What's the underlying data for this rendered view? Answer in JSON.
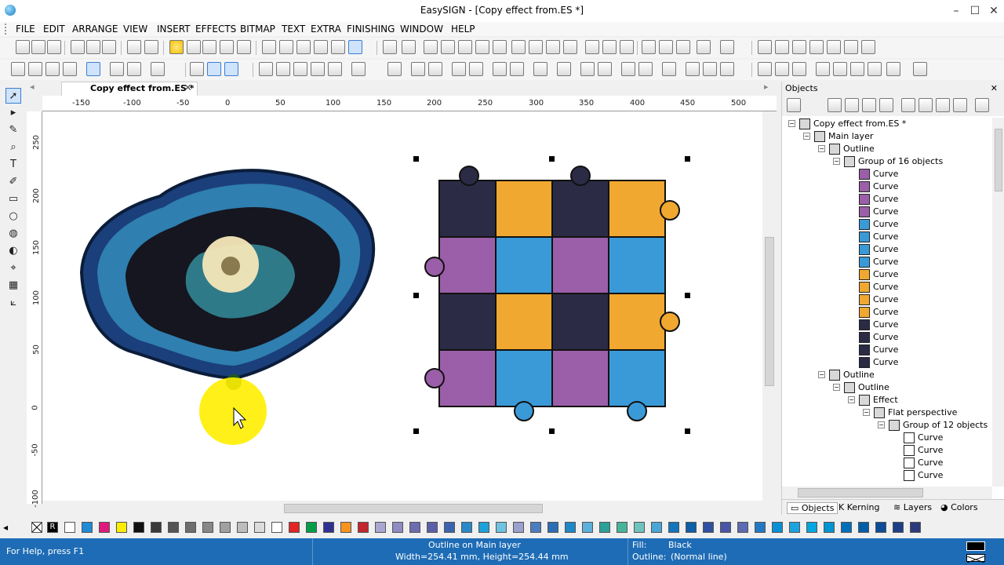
{
  "window": {
    "title": "EasySIGN - [Copy effect from.ES *]",
    "minimize": "–",
    "maximize": "☐",
    "close": "✕"
  },
  "menu": [
    "FILE",
    "EDIT",
    "ARRANGE",
    "VIEW",
    "INSERT",
    "EFFECTS",
    "BITMAP",
    "TEXT",
    "EXTRA",
    "FINISHING",
    "WINDOW",
    "HELP"
  ],
  "document": {
    "tab_label": "Copy effect from.ES *",
    "tab_close": "✕"
  },
  "ruler": {
    "h": [
      "-150",
      "-100",
      "-50",
      "0",
      "50",
      "100",
      "150",
      "200",
      "250",
      "300",
      "350",
      "400",
      "450",
      "500"
    ],
    "v": [
      "250",
      "200",
      "150",
      "100",
      "50",
      "0",
      "-50",
      "-100"
    ]
  },
  "objects_panel": {
    "title": "Objects",
    "close": "✕",
    "tree": [
      {
        "label": "Copy effect from.ES *",
        "depth": 0,
        "exp": "−",
        "icon": "document"
      },
      {
        "label": "Main layer",
        "depth": 1,
        "exp": "−",
        "icon": "layer"
      },
      {
        "label": "Outline",
        "depth": 2,
        "exp": "−",
        "icon": "outline"
      },
      {
        "label": "Group of 16 objects",
        "depth": 3,
        "exp": "−",
        "icon": "group"
      },
      {
        "label": "Curve",
        "depth": 4,
        "color": "#9b5ea8"
      },
      {
        "label": "Curve",
        "depth": 4,
        "color": "#9b5ea8"
      },
      {
        "label": "Curve",
        "depth": 4,
        "color": "#9b5ea8"
      },
      {
        "label": "Curve",
        "depth": 4,
        "color": "#9b5ea8"
      },
      {
        "label": "Curve",
        "depth": 4,
        "color": "#3a9ad8"
      },
      {
        "label": "Curve",
        "depth": 4,
        "color": "#3a9ad8"
      },
      {
        "label": "Curve",
        "depth": 4,
        "color": "#3a9ad8"
      },
      {
        "label": "Curve",
        "depth": 4,
        "color": "#3a9ad8"
      },
      {
        "label": "Curve",
        "depth": 4,
        "color": "#f0a830"
      },
      {
        "label": "Curve",
        "depth": 4,
        "color": "#f0a830"
      },
      {
        "label": "Curve",
        "depth": 4,
        "color": "#f0a830"
      },
      {
        "label": "Curve",
        "depth": 4,
        "color": "#f0a830"
      },
      {
        "label": "Curve",
        "depth": 4,
        "color": "#2b2b45"
      },
      {
        "label": "Curve",
        "depth": 4,
        "color": "#2b2b45"
      },
      {
        "label": "Curve",
        "depth": 4,
        "color": "#2b2b45"
      },
      {
        "label": "Curve",
        "depth": 4,
        "color": "#2b2b45"
      },
      {
        "label": "Outline",
        "depth": 2,
        "exp": "−",
        "icon": "outline"
      },
      {
        "label": "Outline",
        "depth": 3,
        "exp": "−",
        "icon": "outline"
      },
      {
        "label": "Effect",
        "depth": 4,
        "exp": "−",
        "icon": "effect"
      },
      {
        "label": "Flat perspective",
        "depth": 5,
        "exp": "−",
        "icon": "perspective"
      },
      {
        "label": "Group of 12 objects",
        "depth": 6,
        "exp": "−",
        "icon": "group"
      },
      {
        "label": "Curve",
        "depth": 7,
        "color": "#ffffff"
      },
      {
        "label": "Curve",
        "depth": 7,
        "color": "#ffffff"
      },
      {
        "label": "Curve",
        "depth": 7,
        "color": "#ffffff"
      },
      {
        "label": "Curve",
        "depth": 7,
        "color": "#ffffff"
      }
    ],
    "tabs": [
      "Objects",
      "Kerning",
      "Layers",
      "Colors"
    ]
  },
  "palette": [
    "#ffffff",
    "#1f8ad6",
    "#e0197d",
    "#ffed00",
    "#111111",
    "#3a3a3a",
    "#555555",
    "#6e6e6e",
    "#888888",
    "#a0a0a0",
    "#bdbdbd",
    "#dcdcdc",
    "#ffffff",
    "#e32524",
    "#009e49",
    "#2e3192",
    "#f7941d",
    "#c1272d",
    "#a9a7d2",
    "#8f8bc3",
    "#6d6cb0",
    "#5b5fa8",
    "#3c64ae",
    "#2b88c8",
    "#1da1d9",
    "#6fc3e0",
    "#9aa1cf",
    "#4c7dbf",
    "#2d6db5",
    "#1e88c8",
    "#5bb0dc",
    "#2aa198",
    "#47b49a",
    "#6ec3bf",
    "#4aa6d6",
    "#1475bd",
    "#0e5ea8",
    "#2f4fa0",
    "#4a56a6",
    "#5d6bb1",
    "#2378c4",
    "#0a8fd6",
    "#1ba3e0",
    "#00a7e0",
    "#0094d3",
    "#0070ba",
    "#005da8",
    "#0f4c97",
    "#1c3f86",
    "#2b3a7a"
  ],
  "status": {
    "help": "For Help, press F1",
    "selection": "Outline on Main layer",
    "size": "Width=254.41 mm, Height=254.44 mm",
    "fill_label": "Fill:",
    "fill_value": "Black",
    "outline_label": "Outline:",
    "outline_value": "(Normal line)",
    "fill_color": "#000000"
  }
}
